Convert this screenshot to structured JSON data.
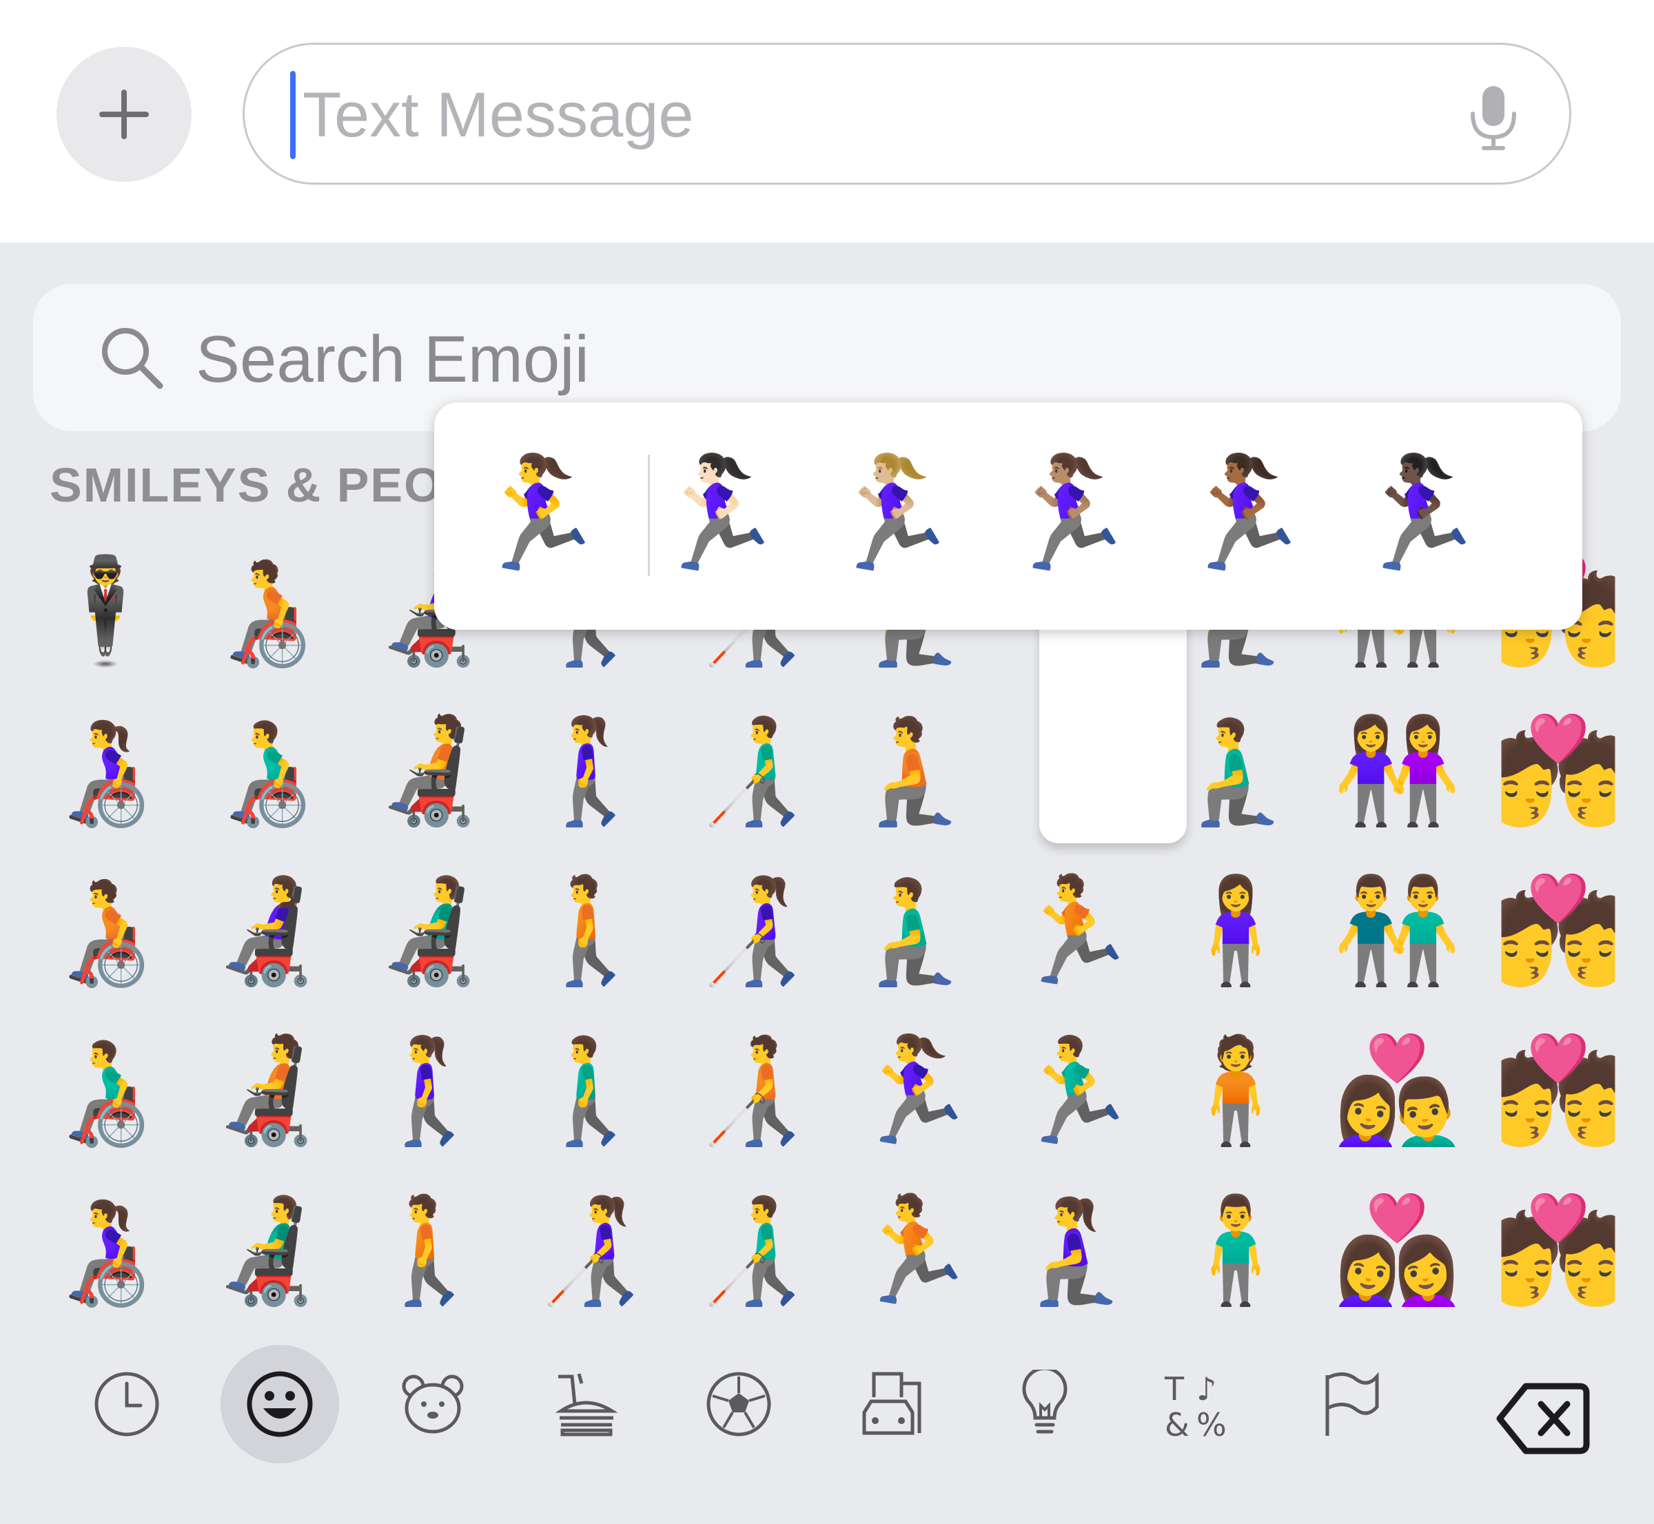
{
  "compose": {
    "placeholder": "Text Message",
    "plus_icon": "plus-icon",
    "mic_icon": "microphone-icon"
  },
  "emoji_keyboard": {
    "search_placeholder": "Search Emoji",
    "section_title": "SMILEYS & PEO",
    "grid": [
      [
        "🕴",
        "🧑‍🦽",
        "👩‍🦼",
        "🚶‍♂️",
        "👨‍🦯",
        "🧎‍♀️",
        "🧎",
        "🧎",
        "👭",
        "💏"
      ],
      [
        "👩‍🦽",
        "👨‍🦽",
        "🧑‍🦼",
        "🚶‍♀️",
        "👨‍🦯",
        "🧎",
        "🧎",
        "🧎‍♂️",
        "👭",
        "💏"
      ],
      [
        "🧑‍🦽",
        "👩‍🦼",
        "👨‍🦼",
        "🚶",
        "👩‍🦯",
        "🧎‍♂️",
        "🏃",
        "🧍‍♀️",
        "👬",
        "💏"
      ],
      [
        "👨‍🦽",
        "🧑‍🦼",
        "🚶‍♀️",
        "🚶‍♂️",
        "🧑‍🦯",
        "🏃‍♀️",
        "🏃‍♂️",
        "🧍",
        "👩‍❤️‍👨",
        "💏"
      ],
      [
        "👩‍🦽",
        "👨‍🦼",
        "🚶",
        "👩‍🦯",
        "👨‍🦯",
        "🏃",
        "🧎‍♀️",
        "🧍‍♂️",
        "👩‍❤️‍👩",
        "💏"
      ]
    ],
    "skin_tone_popover": [
      "🏃‍♀️",
      "🏃🏻‍♀️",
      "🏃🏼‍♀️",
      "🏃🏽‍♀️",
      "🏃🏾‍♀️",
      "🏃🏿‍♀️"
    ],
    "categories": [
      {
        "name": "recent",
        "icon": "clock-icon",
        "active": false
      },
      {
        "name": "smileys-people",
        "icon": "smiley-icon",
        "active": true
      },
      {
        "name": "animals-nature",
        "icon": "bear-icon",
        "active": false
      },
      {
        "name": "food-drink",
        "icon": "burger-icon",
        "active": false
      },
      {
        "name": "activity",
        "icon": "soccer-ball-icon",
        "active": false
      },
      {
        "name": "travel-places",
        "icon": "car-building-icon",
        "active": false
      },
      {
        "name": "objects",
        "icon": "lightbulb-icon",
        "active": false
      },
      {
        "name": "symbols",
        "icon": "symbols-icon",
        "active": false
      },
      {
        "name": "flags",
        "icon": "flag-icon",
        "active": false
      }
    ],
    "symbols_icon_text": [
      "T",
      "♪",
      "&",
      "%"
    ],
    "delete_icon": "delete-backward-icon"
  }
}
